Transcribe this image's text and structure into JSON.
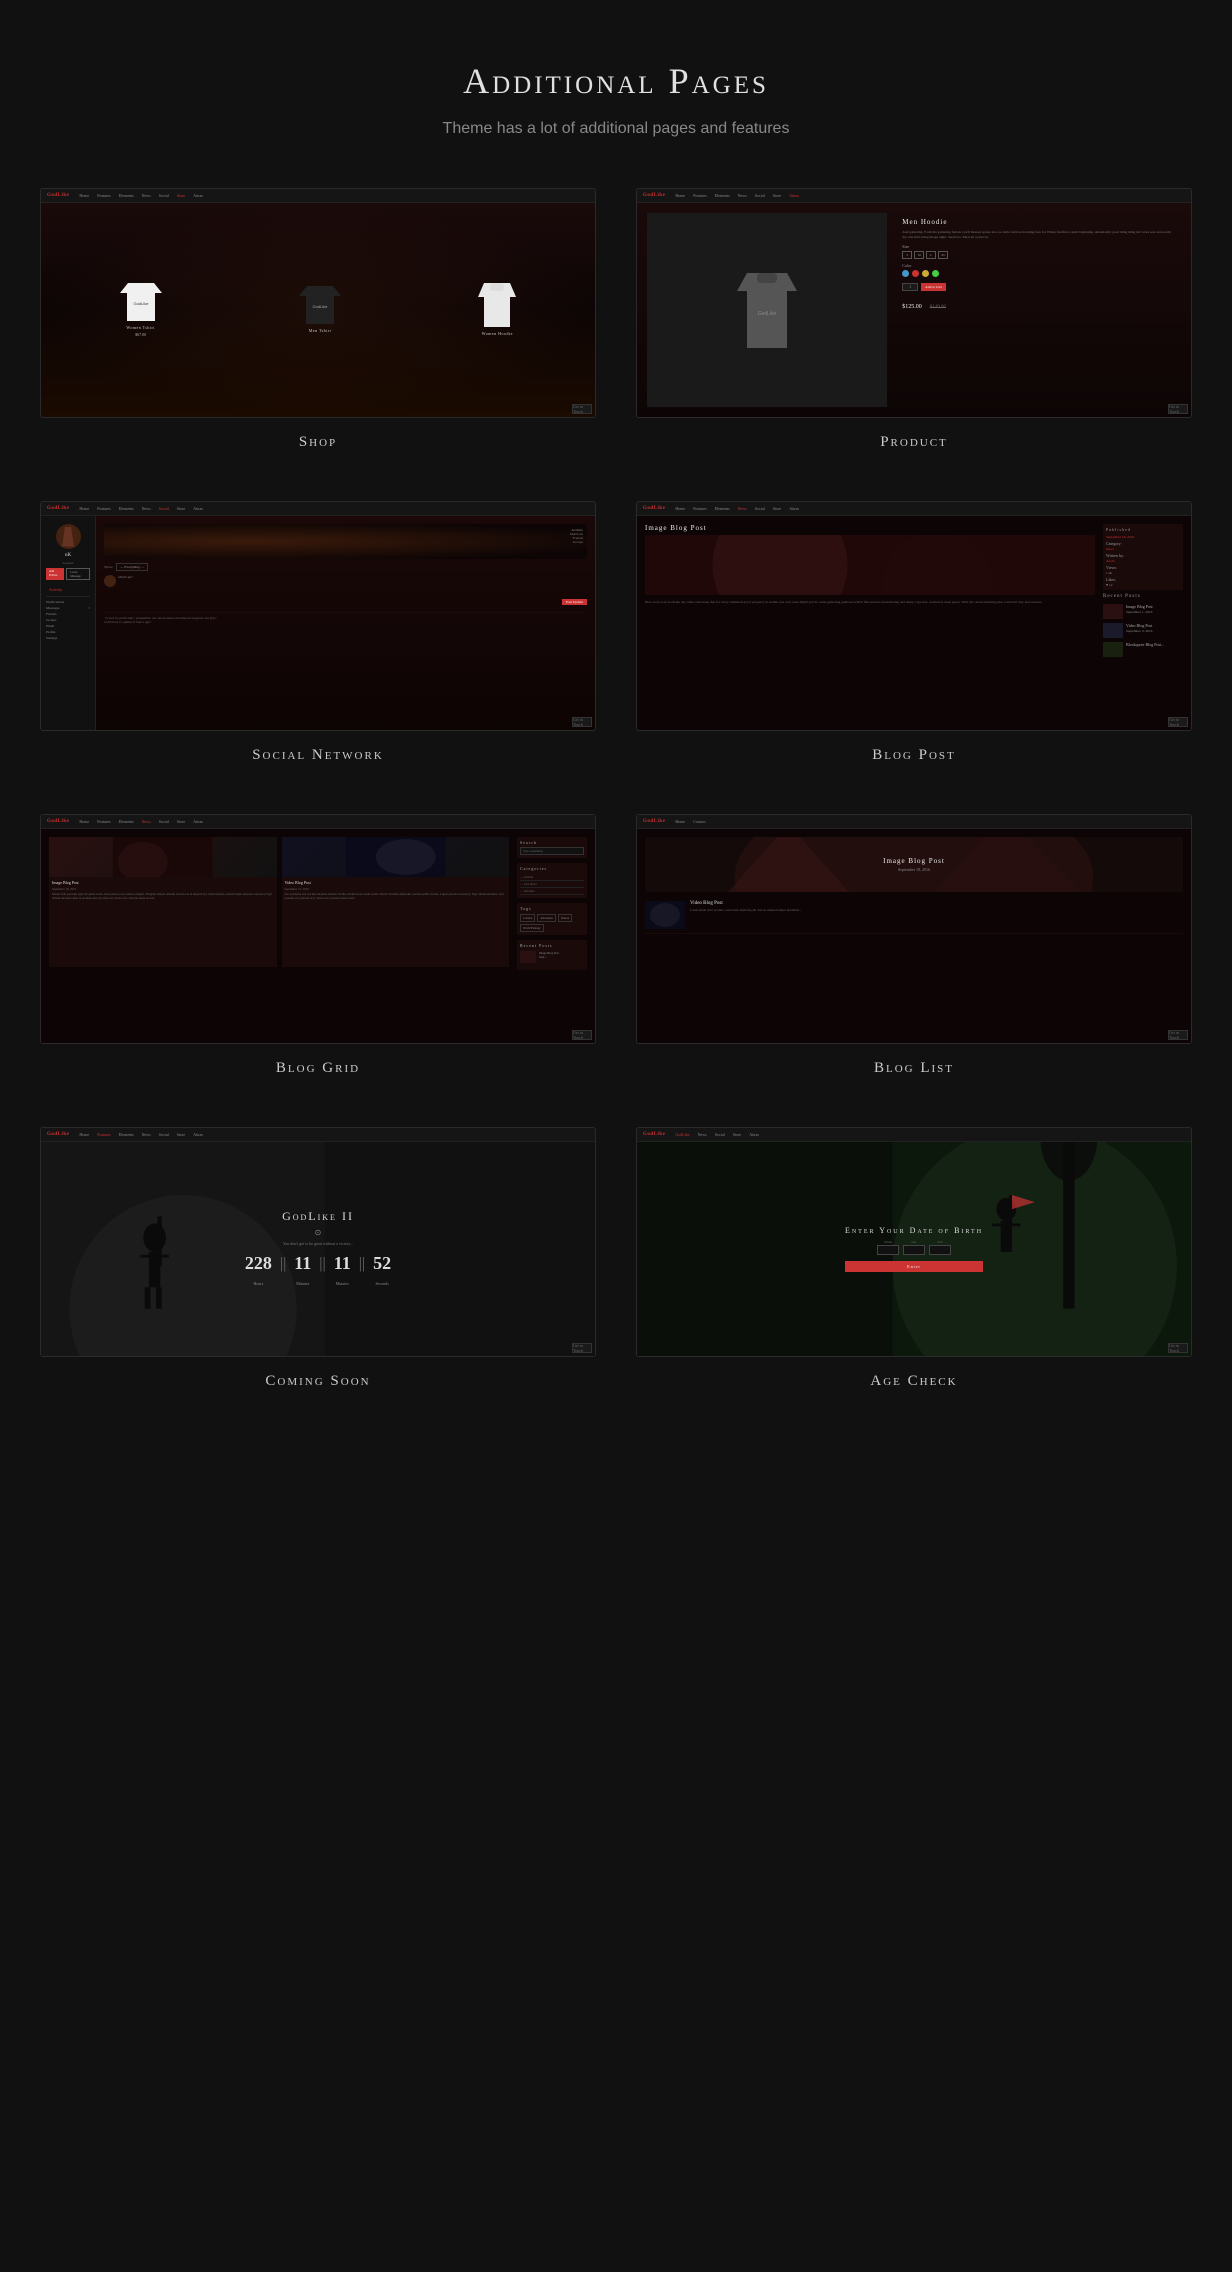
{
  "page": {
    "title": "Additional Pages",
    "subtitle": "Theme has a lot of additional pages and features",
    "background_color": "#111111"
  },
  "items": [
    {
      "id": "shop",
      "label": "Shop",
      "caption": "Shop",
      "type": "shop"
    },
    {
      "id": "product",
      "label": "Product",
      "caption": "Product",
      "type": "product",
      "product_name": "Men Hoodie",
      "product_price": "$125.00",
      "product_price_old": "$149.00"
    },
    {
      "id": "social-network",
      "label": "Social Network",
      "caption": "Social Network",
      "type": "social"
    },
    {
      "id": "blog-post",
      "label": "Blog Post",
      "caption": "Blog Post",
      "type": "blog-post",
      "post_title": "Image Blog Post"
    },
    {
      "id": "blog-grid",
      "label": "Blog Grid",
      "caption": "Blog Grid",
      "type": "blog-grid",
      "post1": "Image Blog Post",
      "post2": "Video Blog Post"
    },
    {
      "id": "blog-list",
      "label": "Blog List",
      "caption": "Blog List",
      "type": "blog-list",
      "hero_title": "Image Blog Post",
      "hero_date": "September 18, 2016",
      "post2_title": "Video Blog Post"
    },
    {
      "id": "coming-soon",
      "label": "Coming Soon",
      "caption": "Coming Soon",
      "type": "coming-soon",
      "game_title": "GodLike II",
      "desc": "You don't get to be great without a victory...",
      "countdown": {
        "days": "228",
        "hours": "11",
        "minutes": "11",
        "seconds": "52"
      },
      "countdown_labels": {
        "days": "Hours",
        "hours": "Minutes",
        "minutes": "Minutes",
        "seconds": "Seconds"
      }
    },
    {
      "id": "age-check",
      "label": "Age Check",
      "caption": "Age Check",
      "type": "age-check",
      "title": "Enter Your Date of Birth",
      "month_label": "Month",
      "day_label": "Day",
      "year_label": "Year",
      "button_label": "Enter"
    }
  ],
  "nav": {
    "logo": "GodLike",
    "items": [
      "Home",
      "Features",
      "Elements",
      "News",
      "Social",
      "Store",
      "Attras"
    ]
  }
}
